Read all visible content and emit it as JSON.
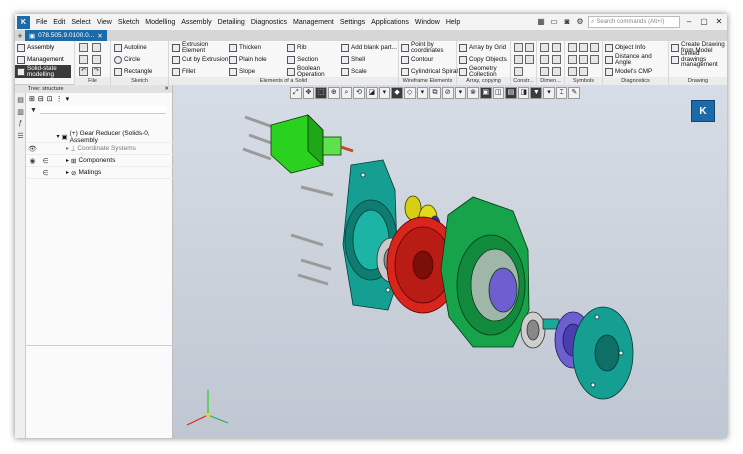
{
  "menu": {
    "items": [
      "File",
      "Edit",
      "Select",
      "View",
      "Sketch",
      "Modelling",
      "Assembly",
      "Detailing",
      "Diagnostics",
      "Management",
      "Settings",
      "Applications",
      "Window",
      "Help"
    ],
    "search_placeholder": "Search commands (Alt+/)"
  },
  "tabs": [
    {
      "label": "078.505.9.0100.0..."
    }
  ],
  "ribbon": {
    "modes": [
      "Assembly",
      "Management",
      "Solid-state modelling"
    ],
    "file_group": "File",
    "sketch": {
      "items": [
        "Autoline",
        "Circle",
        "Rectangle"
      ],
      "label": "Sketch"
    },
    "solid": {
      "col1": [
        "Extrusion Element",
        "Cut by Extrusion",
        "Fillet"
      ],
      "col2": [
        "Thicken",
        "Plain hole",
        "Slope"
      ],
      "col3": [
        "Rib",
        "Section",
        "Boolean Operation"
      ],
      "col4": [
        "Add blank part...",
        "Shell",
        "Scale"
      ],
      "label": "Elements of a Solid"
    },
    "wireframe": {
      "items": [
        "Point by coordinates",
        "Contour",
        "Cylindrical Spiral"
      ],
      "label": "Wireframe Elements"
    },
    "array": {
      "items": [
        "Array by Grid",
        "Copy Objects",
        "Geometry Collection"
      ],
      "label": "Array, copying"
    },
    "constr_label": "Constr...",
    "dimen_label": "Dimen...",
    "symbols_label": "Symbols",
    "diagnostics": {
      "items": [
        "Object Info",
        "Distance and Angle",
        "Model's CMP"
      ],
      "label": "Diagnostics"
    },
    "drawing": {
      "items": [
        "Create Drawing from Model",
        "Linked drawings management"
      ],
      "label": "Drawing"
    }
  },
  "tree": {
    "title": "Tree: structure",
    "filter_placeholder": "",
    "rows": [
      {
        "label": "(+) Gear Reducer (Solids-0, Assembly",
        "level": 0
      },
      {
        "label": "Coordinate Systems",
        "level": 1
      },
      {
        "label": "Components",
        "level": 1
      },
      {
        "label": "Matings",
        "level": 1
      }
    ]
  },
  "colors": {
    "accent": "#1c6aa8",
    "housing": "#159f92",
    "cover": "#17a34a",
    "gear": "#d9261c",
    "flange": "#6d5fd0",
    "motor": "#2ad11e"
  }
}
